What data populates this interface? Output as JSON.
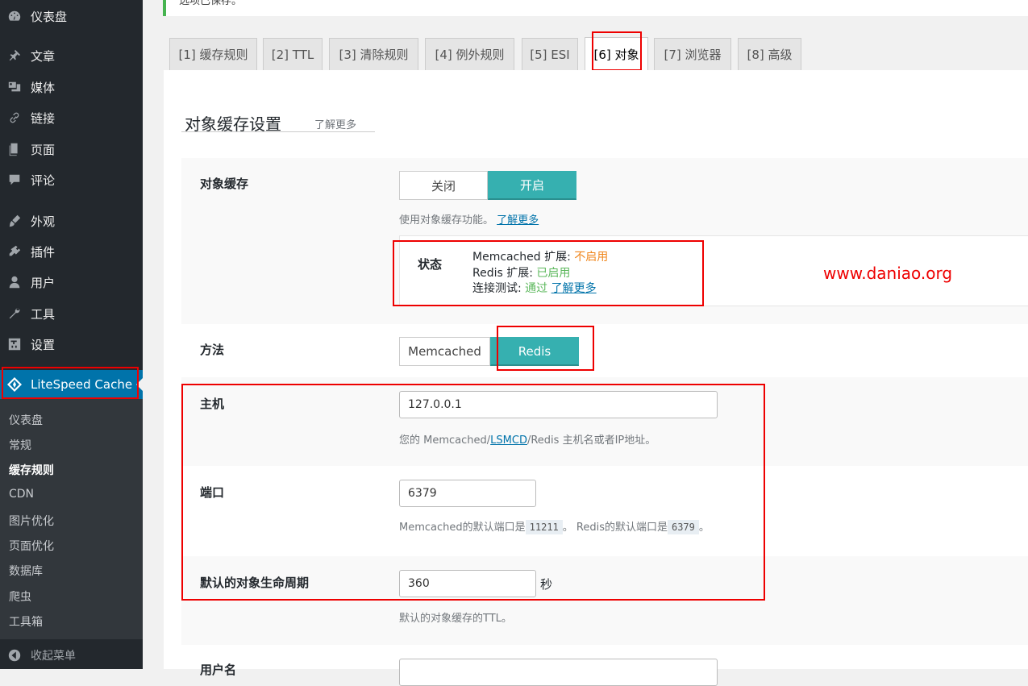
{
  "sidebar": {
    "items": [
      {
        "label": "仪表盘",
        "icon": "dashboard-icon"
      },
      {
        "label": "文章",
        "icon": "pin-icon"
      },
      {
        "label": "媒体",
        "icon": "media-icon"
      },
      {
        "label": "链接",
        "icon": "link-icon"
      },
      {
        "label": "页面",
        "icon": "page-icon"
      },
      {
        "label": "评论",
        "icon": "comment-icon"
      },
      {
        "label": "外观",
        "icon": "appearance-icon"
      },
      {
        "label": "插件",
        "icon": "plugin-icon"
      },
      {
        "label": "用户",
        "icon": "user-icon"
      },
      {
        "label": "工具",
        "icon": "tools-icon"
      },
      {
        "label": "设置",
        "icon": "settings-icon"
      }
    ],
    "litespeed": {
      "label": "LiteSpeed Cache",
      "icon": "litespeed-diamond-icon"
    },
    "submenu": [
      "仪表盘",
      "常规",
      "缓存规则",
      "CDN",
      "图片优化",
      "页面优化",
      "数据库",
      "爬虫",
      "工具箱"
    ],
    "submenu_current": "缓存规则",
    "collapse": {
      "label": "收起菜单",
      "icon": "collapse-arrow-icon"
    }
  },
  "notice": {
    "text": "选项已保存。"
  },
  "tabs": [
    {
      "label": "[1] 缓存规则"
    },
    {
      "label": "[2] TTL"
    },
    {
      "label": "[3] 清除规则"
    },
    {
      "label": "[4] 例外规则"
    },
    {
      "label": "[5] ESI"
    },
    {
      "label": "[6] 对象"
    },
    {
      "label": "[7] 浏览器"
    },
    {
      "label": "[8] 高级"
    }
  ],
  "section": {
    "title": "对象缓存设置",
    "learn_more": "了解更多"
  },
  "object_cache": {
    "label": "对象缓存",
    "off": "关闭",
    "on": "开启",
    "desc": "使用对象缓存功能。",
    "learn_more": "了解更多"
  },
  "status": {
    "label": "状态",
    "memcached_prefix": "Memcached 扩展: ",
    "memcached_value": "不启用",
    "redis_prefix": "Redis 扩展: ",
    "redis_value": "已启用",
    "test_prefix": "连接测试: ",
    "test_value": "通过",
    "learn_more": "了解更多"
  },
  "watermark": "www.daniao.org",
  "method": {
    "label": "方法",
    "opt1": "Memcached",
    "opt2": "Redis"
  },
  "host": {
    "label": "主机",
    "value": "127.0.0.1",
    "desc_pre": "您的 Memcached/",
    "desc_link": "LSMCD",
    "desc_post": "/Redis 主机名或者IP地址。"
  },
  "port": {
    "label": "端口",
    "value": "6379",
    "desc1": "Memcached的默认端口是",
    "code1": "11211",
    "desc2": "。 Redis的默认端口是",
    "code2": "6379",
    "desc3": "。"
  },
  "lifetime": {
    "label": "默认的对象生命周期",
    "value": "360",
    "unit": "秒",
    "desc": "默认的对象缓存的TTL。"
  },
  "username": {
    "label": "用户名"
  }
}
